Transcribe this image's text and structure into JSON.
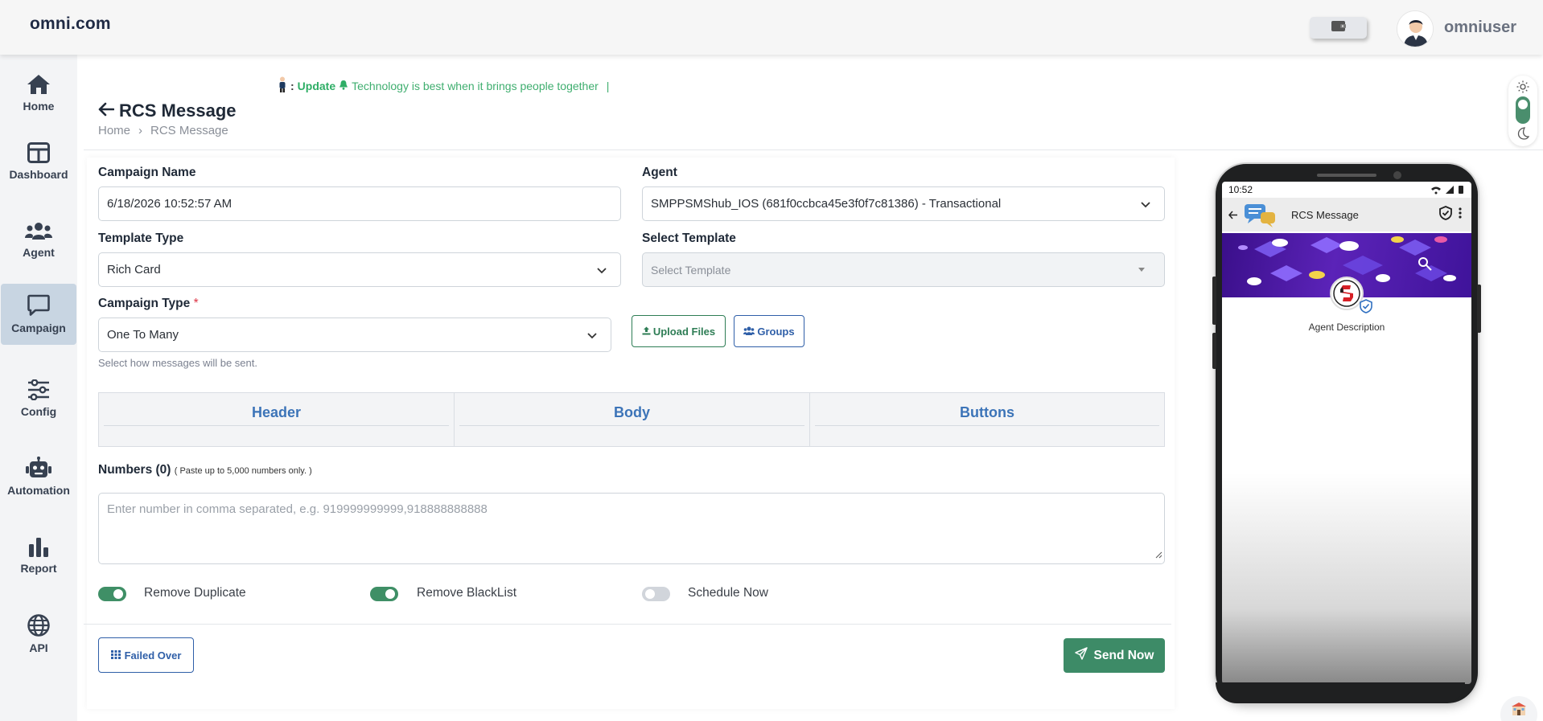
{
  "app": {
    "brand": "omni.com",
    "user_name": "omniuser"
  },
  "sidebar": {
    "items": [
      {
        "label": "Home",
        "icon": "home-icon"
      },
      {
        "label": "Dashboard",
        "icon": "dashboard-icon"
      },
      {
        "label": "Agent",
        "icon": "users-icon"
      },
      {
        "label": "Campaign",
        "icon": "chat-icon",
        "active": true
      },
      {
        "label": "Config",
        "icon": "sliders-icon"
      },
      {
        "label": "Automation",
        "icon": "robot-icon"
      },
      {
        "label": "Report",
        "icon": "bar-chart-icon"
      },
      {
        "label": "API",
        "icon": "globe-icon"
      }
    ]
  },
  "ticker": {
    "prefix": ": ",
    "update": "Update",
    "message": "Technology is best when it brings people together",
    "cursor": "|"
  },
  "page": {
    "title": "RCS Message",
    "breadcrumb": [
      "Home",
      "RCS Message"
    ],
    "breadcrumb_separator": "›"
  },
  "form": {
    "campaign_name": {
      "label": "Campaign Name",
      "value": "6/18/2026 10:52:57 AM"
    },
    "agent": {
      "label": "Agent",
      "value": "SMPPSMShub_IOS (681f0ccbca45e3f0f7c81386) - Transactional"
    },
    "template_type": {
      "label": "Template Type",
      "value": "Rich Card"
    },
    "select_template": {
      "label": "Select Template",
      "placeholder": "Select Template"
    },
    "campaign_type": {
      "label": "Campaign Type",
      "required_mark": "*",
      "value": "One To Many",
      "help": "Select how messages will be sent."
    },
    "upload_files_label": "Upload Files",
    "groups_label": "Groups",
    "tabs": [
      "Header",
      "Body",
      "Buttons"
    ],
    "numbers": {
      "label": "Numbers (0)",
      "hint": "( Paste up to 5,000 numbers only. )",
      "placeholder": "Enter number in comma separated, e.g. 919999999999,918888888888"
    },
    "toggles": [
      {
        "label": "Remove Duplicate",
        "on": true
      },
      {
        "label": "Remove BlackList",
        "on": true
      },
      {
        "label": "Schedule Now",
        "on": false
      }
    ],
    "failed_over_label": "Failed Over",
    "send_now_label": "Send Now"
  },
  "preview": {
    "time": "10:52",
    "title": "RCS Message",
    "agent_description": "Agent Description"
  },
  "colors": {
    "primary_green": "#3d8b67",
    "accent_blue": "#2f5fa8",
    "tab_text": "#3c74b8",
    "ticker_green": "#3fae6f",
    "active_nav": "#c8d5e2"
  }
}
